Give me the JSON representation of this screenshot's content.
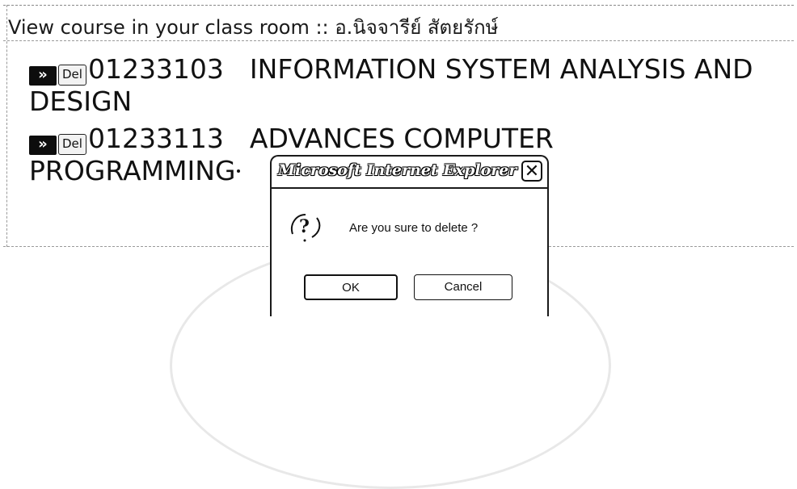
{
  "header": {
    "title": "View course in your class room :: อ.นิจจารีย์ สัตยรักษ์"
  },
  "courses": [
    {
      "go_label": "»",
      "del_label": "Del",
      "code": "01233103",
      "name": "INFORMATION SYSTEM ANALYSIS AND DESIGN"
    },
    {
      "go_label": "»",
      "del_label": "Del",
      "code": "01233113",
      "name": "ADVANCES COMPUTER PROGRAMMING"
    }
  ],
  "dialog": {
    "title": "Microsoft Internet Explorer",
    "close_label": "✕",
    "icon": "question-icon",
    "message": "Are you sure to delete ?",
    "ok_label": "OK",
    "cancel_label": "Cancel"
  }
}
